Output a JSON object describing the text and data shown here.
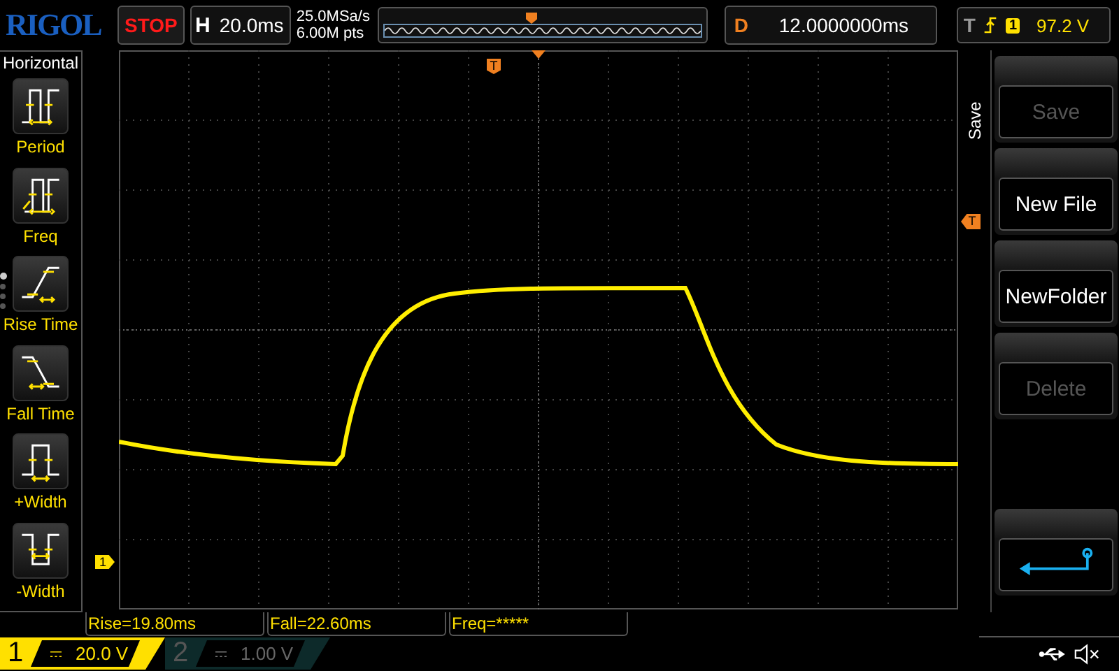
{
  "header": {
    "logo": "RIGOL",
    "run_state": "STOP",
    "timebase_label": "H",
    "timebase": "20.0ms",
    "sample_rate": "25.0MSa/s",
    "memory_depth": "6.00M pts",
    "delay_label": "D",
    "delay": "12.0000000ms",
    "trigger_label": "T",
    "trigger_channel": "1",
    "trigger_level": "97.2 V"
  },
  "sidebar": {
    "title": "Horizontal",
    "items": [
      {
        "label": "Period",
        "kind": "period"
      },
      {
        "label": "Freq",
        "kind": "freq"
      },
      {
        "label": "Rise Time",
        "kind": "rise"
      },
      {
        "label": "Fall Time",
        "kind": "fall"
      },
      {
        "label": "+Width",
        "kind": "pwidth"
      },
      {
        "label": "-Width",
        "kind": "nwidth"
      }
    ],
    "pages": [
      {
        "selected": true
      },
      {
        "selected": false
      },
      {
        "selected": false
      },
      {
        "selected": false
      }
    ]
  },
  "markers": {
    "trigger_position": "T",
    "trigger_level": "T",
    "channel": "1"
  },
  "menu": {
    "title": "Save",
    "buttons": [
      {
        "label": "Save",
        "disabled": true
      },
      {
        "label": "New File",
        "disabled": false
      },
      {
        "label": "NewFolder",
        "disabled": false
      },
      {
        "label": "Delete",
        "disabled": true
      }
    ]
  },
  "measurements": [
    "Rise=19.80ms",
    "Fall=22.60ms",
    "Freq=*****"
  ],
  "channels": [
    {
      "number": "1",
      "scale": "20.0 V",
      "enabled": true
    },
    {
      "number": "2",
      "scale": "1.00 V",
      "enabled": false
    }
  ]
}
